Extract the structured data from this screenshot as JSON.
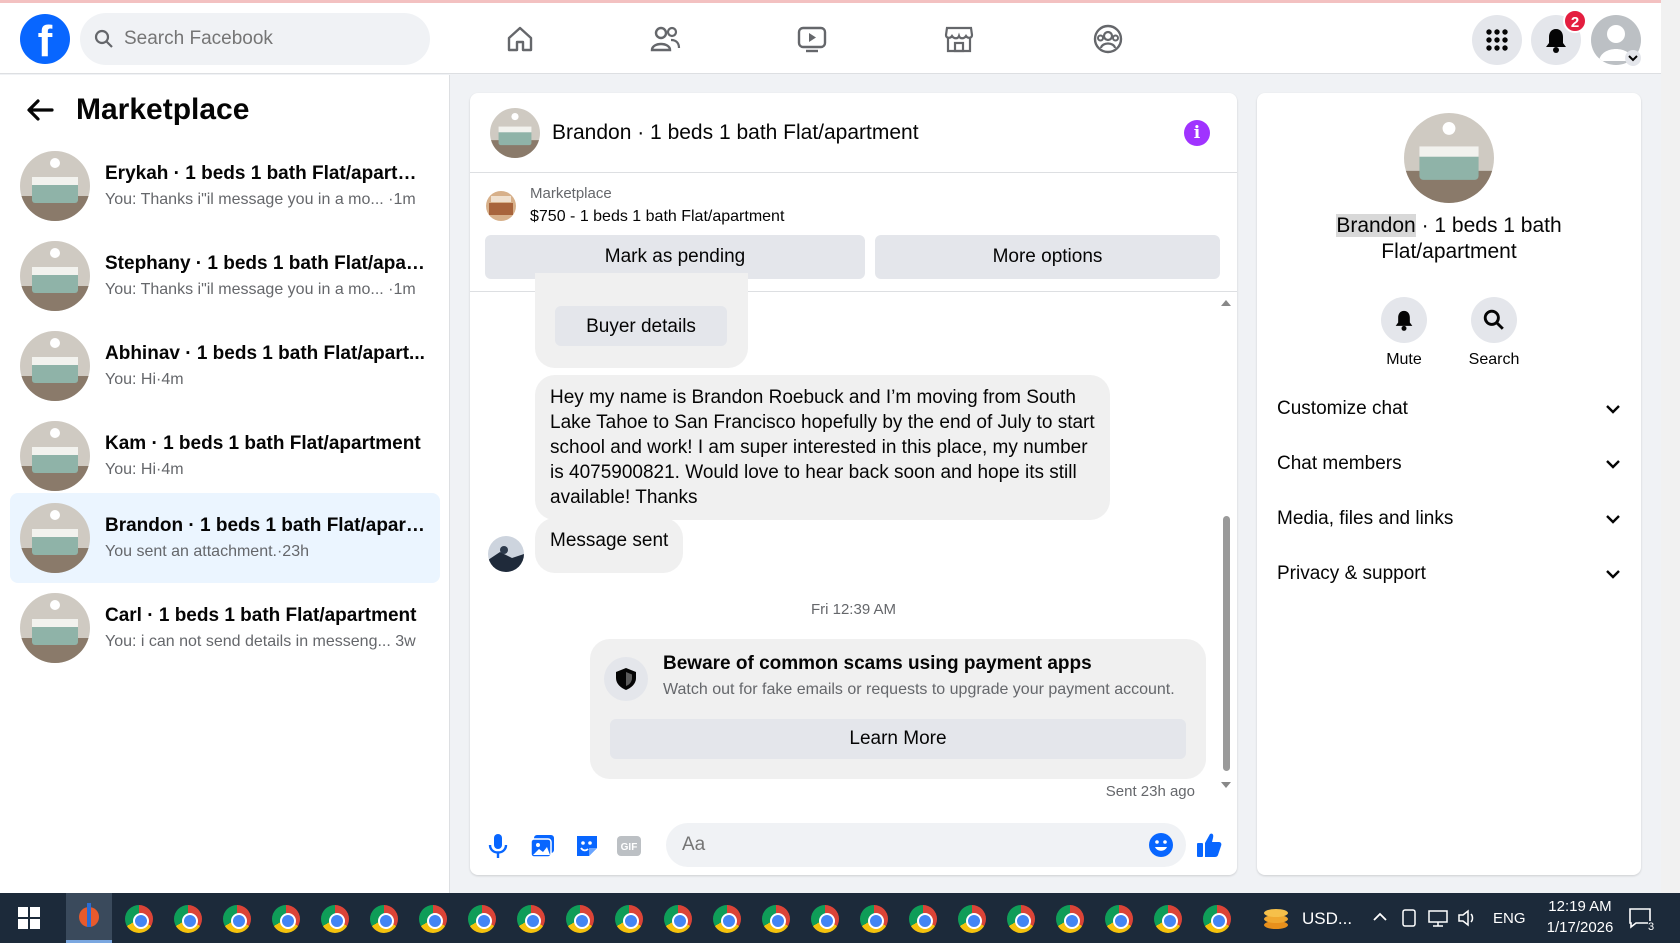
{
  "topbar": {
    "logo": "f",
    "search_placeholder": "Search Facebook",
    "notifications_count": "2",
    "nav_icons": [
      "home-icon",
      "friends-icon",
      "watch-icon",
      "marketplace-icon",
      "groups-icon"
    ]
  },
  "left": {
    "title": "Marketplace",
    "conversations": [
      {
        "name": "Erykah · 1 beds 1 bath Flat/apartm...",
        "preview": "You: Thanks i\"il message you in a mo... ·1m"
      },
      {
        "name": "Stephany · 1 beds 1 bath Flat/apart...",
        "preview": "You: Thanks i\"il message you in a mo... ·1m"
      },
      {
        "name": "Abhinav · 1 beds 1 bath Flat/apart...",
        "preview": "You: Hi·4m"
      },
      {
        "name": "Kam · 1 beds 1 bath Flat/apartment",
        "preview": "You: Hi·4m"
      },
      {
        "name": "Brandon · 1 beds 1 bath Flat/apart...",
        "preview": "You sent an attachment.·23h"
      },
      {
        "name": "Carl · 1 beds 1 bath Flat/apartment",
        "preview": "You: i can not send details in messeng... 3w"
      }
    ]
  },
  "chat": {
    "title": "Brandon · 1 beds 1 bath Flat/apartment",
    "context_label": "Marketplace",
    "context_price": "$750 - 1 beds 1 bath Flat/apartment",
    "mark_pending": "Mark as pending",
    "more_options": "More options",
    "buyer_details": "Buyer details",
    "message": "Hey my name is Brandon Roebuck and I’m moving from South Lake Tahoe to San Francisco hopefully by the end of July to start school and work! I am super interested in this place, my number is 4075900821. Would love to hear back soon and hope its still available! Thanks",
    "message_sent": "Message sent",
    "timestamp": "Fri 12:39 AM",
    "scam_title": "Beware of common scams using payment apps",
    "scam_sub": "Watch out for fake emails or requests to upgrade your payment account.",
    "learn_more": "Learn More",
    "sent_status": "Sent 23h ago",
    "input_placeholder": "Aa"
  },
  "right": {
    "name_highlight": "Brandon",
    "name_rest": " · 1 beds 1 bath",
    "name_line2": "Flat/apartment",
    "mute": "Mute",
    "search": "Search",
    "sections": [
      "Customize chat",
      "Chat members",
      "Media, files and links",
      "Privacy & support"
    ]
  },
  "taskbar": {
    "currency": "USD...",
    "lang": "ENG",
    "time": "12:19 AM",
    "date": "1/17/2026",
    "notif_count": "3"
  },
  "colors": {
    "brand": "#0866ff",
    "active_bg": "#ebf5ff",
    "badge": "#e41e3f",
    "info": "#a033ff",
    "taskbar": "#1c2a3a"
  }
}
